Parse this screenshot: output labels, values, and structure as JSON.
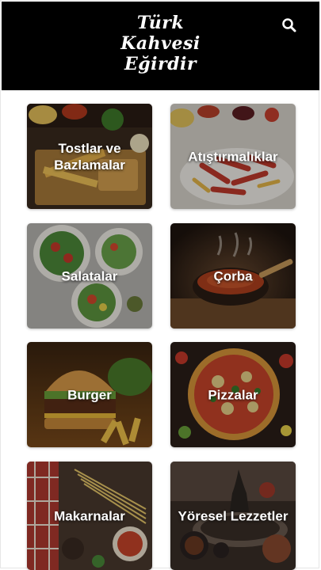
{
  "header": {
    "brand_lines": [
      "Türk",
      "Kahvesi",
      "Eğirdir"
    ],
    "background": "#000000",
    "search_icon": "search-icon"
  },
  "categories": [
    {
      "label": "Tostlar ve Bazlamalar"
    },
    {
      "label": "Atıştırmalıklar"
    },
    {
      "label": "Salatalar"
    },
    {
      "label": "Çorba"
    },
    {
      "label": "Burger"
    },
    {
      "label": "Pizzalar"
    },
    {
      "label": "Makarnalar"
    },
    {
      "label": "Yöresel Lezzetler"
    }
  ]
}
